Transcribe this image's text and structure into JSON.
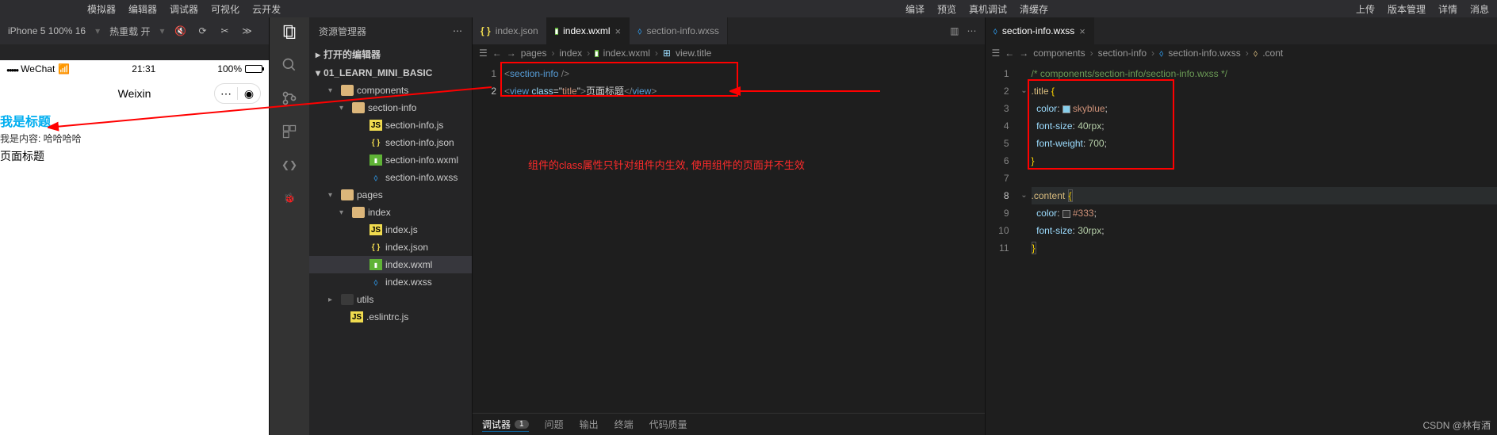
{
  "topMenu": {
    "left": [
      "模拟器",
      "编辑器",
      "调试器",
      "可视化",
      "云开发"
    ],
    "center": [
      "编译",
      "预览",
      "真机调试",
      "清缓存"
    ],
    "right": [
      "上传",
      "版本管理",
      "详情",
      "消息"
    ]
  },
  "simulator": {
    "device": "iPhone 5 100% 16",
    "hotReload": "热重载 开",
    "statusBar": {
      "carrier": "WeChat",
      "time": "21:31",
      "battery": "100%"
    },
    "navTitle": "Weixin",
    "preview": {
      "title": "我是标题",
      "content": "我是内容: 哈哈哈哈",
      "pageTitle": "页面标题"
    }
  },
  "explorer": {
    "header": "资源管理器",
    "sections": {
      "openEditors": "打开的编辑器",
      "project": "01_LEARN_MINI_BASIC"
    },
    "tree": [
      {
        "name": "components",
        "type": "folder",
        "indent": 24,
        "open": true
      },
      {
        "name": "section-info",
        "type": "folder",
        "indent": 38,
        "open": true
      },
      {
        "name": "section-info.js",
        "type": "js",
        "indent": 60
      },
      {
        "name": "section-info.json",
        "type": "json",
        "indent": 60
      },
      {
        "name": "section-info.wxml",
        "type": "wxml",
        "indent": 60
      },
      {
        "name": "section-info.wxss",
        "type": "wxss",
        "indent": 60
      },
      {
        "name": "pages",
        "type": "folder",
        "indent": 24,
        "open": true
      },
      {
        "name": "index",
        "type": "folder",
        "indent": 38,
        "open": true
      },
      {
        "name": "index.js",
        "type": "js",
        "indent": 60
      },
      {
        "name": "index.json",
        "type": "json",
        "indent": 60
      },
      {
        "name": "index.wxml",
        "type": "wxml",
        "indent": 60,
        "active": true
      },
      {
        "name": "index.wxss",
        "type": "wxss",
        "indent": 60
      },
      {
        "name": "utils",
        "type": "folder",
        "indent": 24,
        "open": false
      },
      {
        "name": ".eslintrc.js",
        "type": "js",
        "indent": 36
      }
    ]
  },
  "editor1": {
    "tabs": [
      {
        "label": "index.json",
        "icon": "json"
      },
      {
        "label": "index.wxml",
        "icon": "wxml",
        "active": true
      },
      {
        "label": "section-info.wxss",
        "icon": "wxss"
      }
    ],
    "breadcrumb": [
      "pages",
      "index",
      "index.wxml",
      "view.title"
    ],
    "lines": {
      "l1": {
        "open": "<",
        "tag": "section-info",
        "close": " />"
      },
      "l2": {
        "open": "<",
        "tag": "view",
        "attr": " class",
        "eq": "=",
        "q1": "\"",
        "val": "title",
        "q2": "\"",
        "gt": ">",
        "text": "页面标题",
        "co": "</",
        "tag2": "view",
        "end": ">"
      }
    },
    "annotation": "组件的class属性只针对组件内生效, 使用组件的页面并不生效"
  },
  "editor2": {
    "tabs": [
      {
        "label": "section-info.wxss",
        "icon": "wxss",
        "active": true
      }
    ],
    "breadcrumb": [
      "components",
      "section-info",
      "section-info.wxss",
      ".cont"
    ],
    "code": {
      "comment": "/* components/section-info/section-info.wxss */",
      "title_sel": ".title",
      "title_props": [
        {
          "prop": "color",
          "val": "skyblue",
          "swatch": "#87ceeb"
        },
        {
          "prop": "font-size",
          "val": "40rpx"
        },
        {
          "prop": "font-weight",
          "val": "700"
        }
      ],
      "content_sel": ".content",
      "content_props": [
        {
          "prop": "color",
          "val": "#333",
          "swatch": "#333333"
        },
        {
          "prop": "font-size",
          "val": "30rpx"
        }
      ]
    }
  },
  "chart_data": {
    "type": "table",
    "title": "section-info.wxss styles",
    "rows": [
      {
        "selector": ".title",
        "property": "color",
        "value": "skyblue"
      },
      {
        "selector": ".title",
        "property": "font-size",
        "value": "40rpx"
      },
      {
        "selector": ".title",
        "property": "font-weight",
        "value": "700"
      },
      {
        "selector": ".content",
        "property": "color",
        "value": "#333"
      },
      {
        "selector": ".content",
        "property": "font-size",
        "value": "30rpx"
      }
    ]
  },
  "bottomPanel": {
    "tabs": [
      "调试器",
      "问题",
      "输出",
      "终端",
      "代码质量"
    ],
    "badge": "1"
  },
  "watermark": "CSDN @林有酒"
}
